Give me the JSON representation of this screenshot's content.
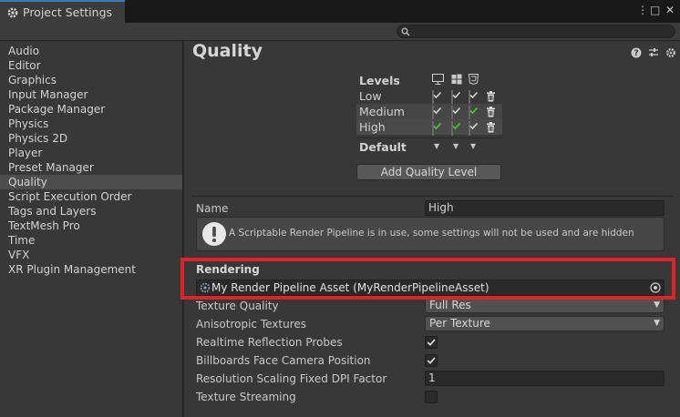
{
  "window": {
    "tab_title": "Project Settings",
    "controls": [
      "⋮",
      "□",
      "✕"
    ]
  },
  "search": {
    "placeholder": ""
  },
  "sidebar": {
    "items": [
      {
        "label": "Audio"
      },
      {
        "label": "Editor"
      },
      {
        "label": "Graphics"
      },
      {
        "label": "Input Manager"
      },
      {
        "label": "Package Manager"
      },
      {
        "label": "Physics"
      },
      {
        "label": "Physics 2D"
      },
      {
        "label": "Player"
      },
      {
        "label": "Preset Manager"
      },
      {
        "label": "Quality"
      },
      {
        "label": "Script Execution Order"
      },
      {
        "label": "Tags and Layers"
      },
      {
        "label": "TextMesh Pro"
      },
      {
        "label": "Time"
      },
      {
        "label": "VFX"
      },
      {
        "label": "XR Plugin Management"
      }
    ],
    "selected": "Quality"
  },
  "main": {
    "title": "Quality",
    "header_icons": [
      "help-icon",
      "presets-icon",
      "settings-icon"
    ],
    "levels": {
      "header": "Levels",
      "platform_icons": [
        "monitor-icon",
        "windows-icon",
        "html5-icon"
      ],
      "rows": [
        {
          "name": "Low",
          "checks": [
            true,
            true,
            true
          ],
          "green": [
            false,
            false,
            false
          ]
        },
        {
          "name": "Medium",
          "checks": [
            true,
            true,
            true
          ],
          "green": [
            false,
            false,
            true
          ]
        },
        {
          "name": "High",
          "checks": [
            true,
            true,
            true
          ],
          "green": [
            true,
            true,
            false
          ]
        }
      ],
      "default_label": "Default",
      "add_button": "Add Quality Level"
    },
    "name_label": "Name",
    "name_value": "High",
    "help_message": "A Scriptable Render Pipeline is in use, some settings will not be used and are hidden",
    "rendering": {
      "section_title": "Rendering",
      "asset_value": "My Render Pipeline Asset (MyRenderPipelineAsset)"
    },
    "settings": {
      "texture_quality_label": "Texture Quality",
      "texture_quality_value": "Full Res",
      "aniso_label": "Anisotropic Textures",
      "aniso_value": "Per Texture",
      "realtime_probes_label": "Realtime Reflection Probes",
      "realtime_probes_checked": true,
      "billboards_label": "Billboards Face Camera Position",
      "billboards_checked": true,
      "dpi_label": "Resolution Scaling Fixed DPI Factor",
      "dpi_value": "1",
      "streaming_label": "Texture Streaming",
      "streaming_checked": false
    }
  },
  "colors": {
    "highlight_border": "#e22129",
    "green_check": "#4fbf3a",
    "accent_tab": "#3a79bb"
  }
}
